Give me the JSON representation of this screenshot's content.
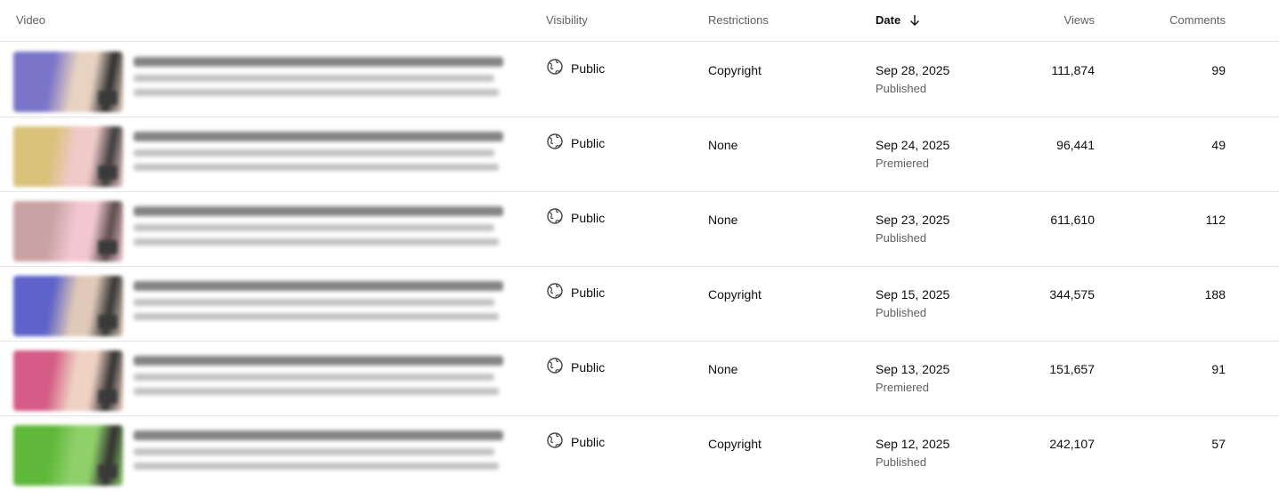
{
  "headers": {
    "video": "Video",
    "visibility": "Visibility",
    "restrictions": "Restrictions",
    "date": "Date",
    "views": "Views",
    "comments": "Comments"
  },
  "rows": [
    {
      "visibility": "Public",
      "restrictions": "Copyright",
      "date": "Sep 28, 2025",
      "status": "Published",
      "views": "111,874",
      "comments": "99",
      "thumb_colors": [
        "#7b75c9",
        "#e8d2c2",
        "#2b2b2b"
      ]
    },
    {
      "visibility": "Public",
      "restrictions": "None",
      "date": "Sep 24, 2025",
      "status": "Premiered",
      "views": "96,441",
      "comments": "49",
      "thumb_colors": [
        "#d9c27a",
        "#f0c9c9",
        "#3a3a3a"
      ]
    },
    {
      "visibility": "Public",
      "restrictions": "None",
      "date": "Sep 23, 2025",
      "status": "Published",
      "views": "611,610",
      "comments": "112",
      "thumb_colors": [
        "#c9a3a3",
        "#f2c7d2",
        "#5a4a4a"
      ]
    },
    {
      "visibility": "Public",
      "restrictions": "Copyright",
      "date": "Sep 15, 2025",
      "status": "Published",
      "views": "344,575",
      "comments": "188",
      "thumb_colors": [
        "#5e63c9",
        "#e0c9b8",
        "#333333"
      ]
    },
    {
      "visibility": "Public",
      "restrictions": "None",
      "date": "Sep 13, 2025",
      "status": "Premiered",
      "views": "151,657",
      "comments": "91",
      "thumb_colors": [
        "#d45c86",
        "#f0d2c4",
        "#2e2e2e"
      ]
    },
    {
      "visibility": "Public",
      "restrictions": "Copyright",
      "date": "Sep 12, 2025",
      "status": "Published",
      "views": "242,107",
      "comments": "57",
      "thumb_colors": [
        "#5fb83a",
        "#8fd06a",
        "#2e2e2e"
      ]
    }
  ]
}
